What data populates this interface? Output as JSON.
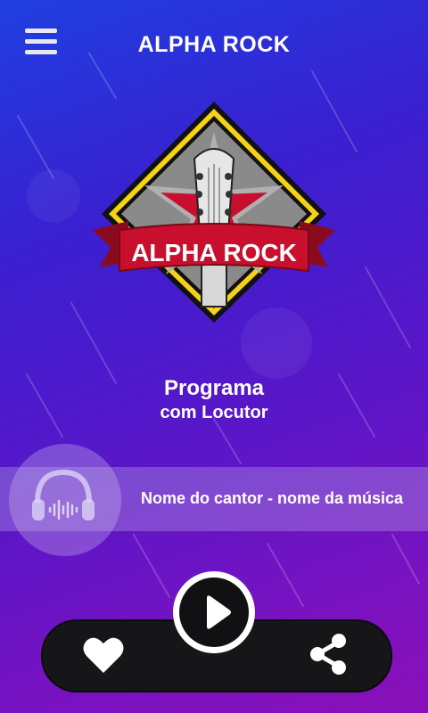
{
  "header": {
    "title": "ALPHA ROCK",
    "menu_icon": "hamburger-menu-icon"
  },
  "logo": {
    "text": "ALPHA ROCK",
    "icon": "guitar-headstock-logo"
  },
  "program": {
    "title": "Programa",
    "host": "com Locutor"
  },
  "now_playing": {
    "icon": "headphones-icon",
    "song": "Nome do cantor - nome da música"
  },
  "controls": {
    "favorite_icon": "heart-icon",
    "play_icon": "play-icon",
    "share_icon": "share-icon"
  },
  "colors": {
    "bg_start": "#1f3fe0",
    "bg_end": "#8a10b8",
    "bar": "#161618",
    "logo_red": "#c8102e",
    "logo_yellow": "#f5d21a"
  }
}
